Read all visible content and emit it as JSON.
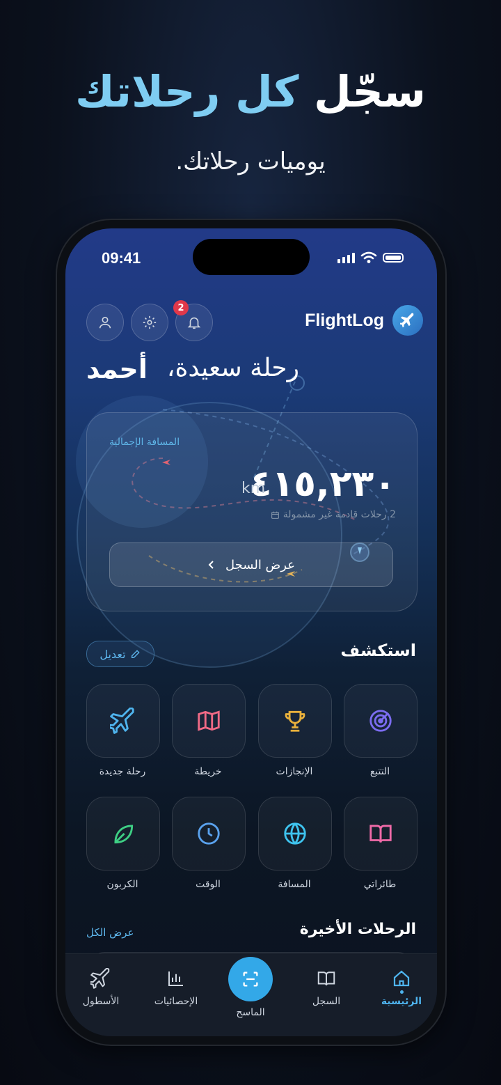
{
  "promo": {
    "headline_part1": "سجّل",
    "headline_part2": "كل رحلاتك",
    "subheadline": "يوميات رحلاتك."
  },
  "status_bar": {
    "time": "09:41"
  },
  "header": {
    "notification_count": "2",
    "app_name": "FlightLog"
  },
  "greeting": {
    "text": "رحلة سعيدة،",
    "name": "أحمد"
  },
  "distance_card": {
    "label": "المسافة الإجمالية",
    "value": "٤١٥,٢٣٠",
    "unit": "km",
    "note": "2 رحلات قادمة غير مشمولة",
    "button_label": "عرض السجل"
  },
  "explore": {
    "title": "استكشف",
    "edit_label": "تعديل",
    "tiles": [
      {
        "label": "التتبع",
        "icon": "radar-icon",
        "color": "#7b6cf0"
      },
      {
        "label": "الإنجازات",
        "icon": "trophy-icon",
        "color": "#e9b13c"
      },
      {
        "label": "خريطة",
        "icon": "map-icon",
        "color": "#f06a86"
      },
      {
        "label": "رحلة جديدة",
        "icon": "plane-icon",
        "color": "#4fb4ee"
      },
      {
        "label": "طائراتي",
        "icon": "book-icon",
        "color": "#f06aa8"
      },
      {
        "label": "المسافة",
        "icon": "globe-icon",
        "color": "#3ec3ee"
      },
      {
        "label": "الوقت",
        "icon": "clock-icon",
        "color": "#5aa2ee"
      },
      {
        "label": "الكربون",
        "icon": "leaf-icon",
        "color": "#3ecf84"
      }
    ]
  },
  "recent": {
    "title": "الرحلات الأخيرة",
    "see_all": "عرض الكل"
  },
  "bottom_nav": {
    "items": [
      {
        "label": "الرئيسية",
        "icon": "home-icon",
        "active": true
      },
      {
        "label": "السجل",
        "icon": "book-icon",
        "active": false
      },
      {
        "label": "الماسح",
        "icon": "scan-icon",
        "active": false
      },
      {
        "label": "الإحصائيات",
        "icon": "bar-chart-icon",
        "active": false
      },
      {
        "label": "الأسطول",
        "icon": "plane-icon",
        "active": false
      }
    ],
    "active_color": "#4fb4ee"
  }
}
